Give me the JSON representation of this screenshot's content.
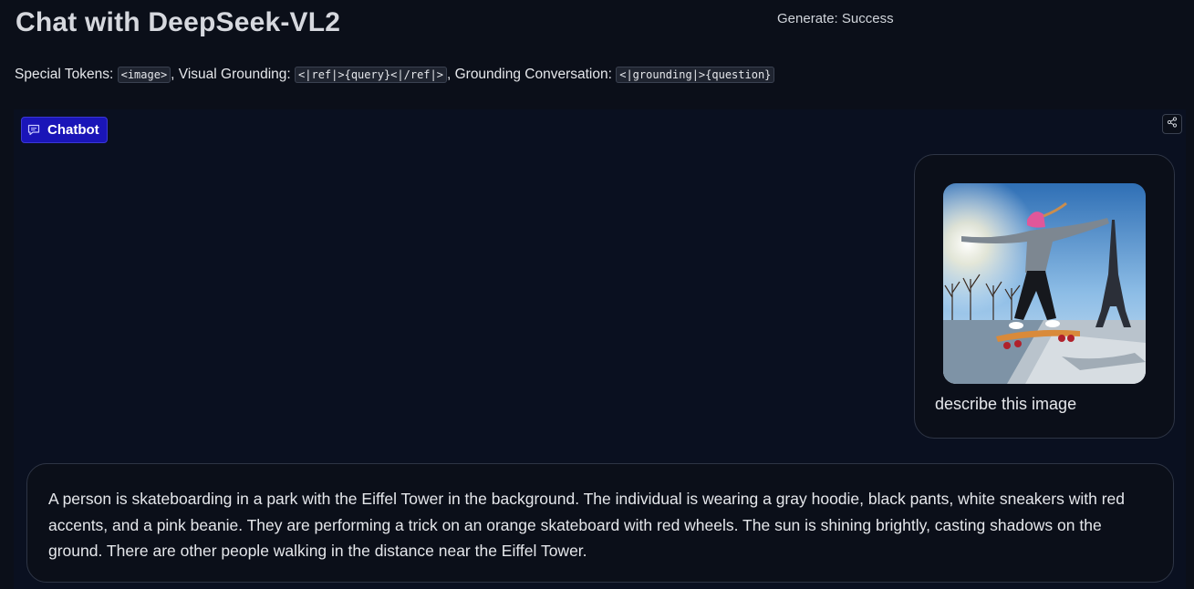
{
  "header": {
    "title": "Chat with DeepSeek-VL2",
    "status": "Generate: Success"
  },
  "tokens": {
    "special_label": "Special Tokens: ",
    "special_code": "<image>",
    "visual_label": ", Visual Grounding: ",
    "visual_code": "<|ref|>{query}<|/ref|>",
    "conversation_label": ", Grounding Conversation: ",
    "conversation_code": "<|grounding|>{question}"
  },
  "chatbot": {
    "label": "Chatbot",
    "icon": "chat-bubble-icon",
    "share_icon": "share-icon"
  },
  "messages": {
    "user": {
      "text": "describe this image",
      "image_icon": "skateboarder-eiffel-photo"
    },
    "bot": {
      "text": "A person is skateboarding in a park with the Eiffel Tower in the background. The individual is wearing a gray hoodie, black pants, white sneakers with red accents, and a pink beanie. They are performing a trick on an orange skateboard with red wheels. The sun is shining brightly, casting shadows on the ground. There are other people walking in the distance near the Eiffel Tower."
    }
  },
  "colors": {
    "background": "#0b0f19",
    "chatbot_label_bg": "#1a15b8",
    "border": "#2e3545"
  }
}
